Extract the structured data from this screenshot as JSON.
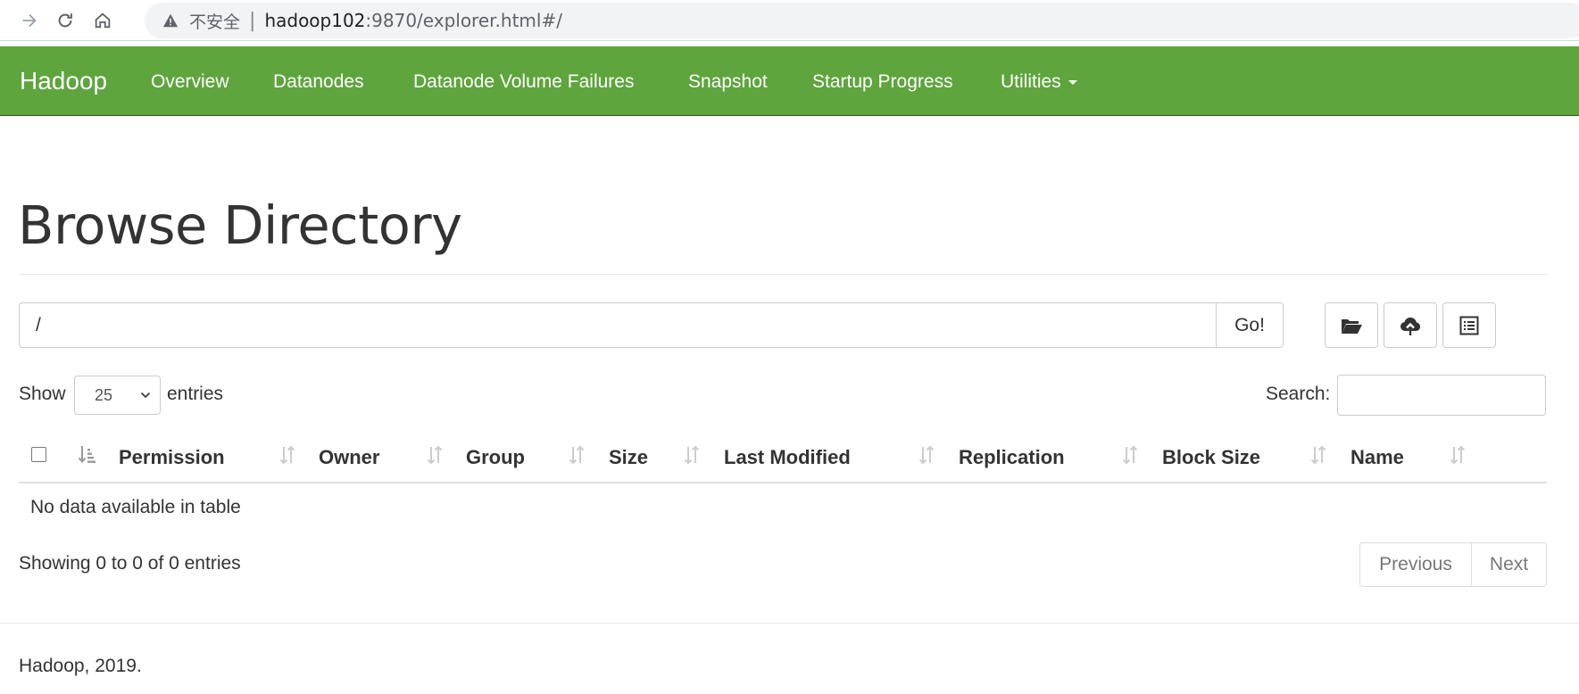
{
  "browser": {
    "insecure_label": "不安全",
    "url_host": "hadoop102",
    "url_rest": ":9870/explorer.html#/"
  },
  "navbar": {
    "brand": "Hadoop",
    "items": [
      {
        "label": "Overview"
      },
      {
        "label": "Datanodes"
      },
      {
        "label": "Datanode Volume Failures"
      },
      {
        "label": "Snapshot"
      },
      {
        "label": "Startup Progress"
      },
      {
        "label": "Utilities"
      }
    ]
  },
  "page": {
    "title": "Browse Directory",
    "path_value": "/",
    "go_label": "Go!",
    "toolbar_icons": [
      "folder-open-icon",
      "cloud-upload-icon",
      "list-icon"
    ]
  },
  "table_controls": {
    "show_label": "Show",
    "entries_value": "25",
    "entries_label": "entries",
    "search_label": "Search:"
  },
  "table": {
    "columns": [
      "Permission",
      "Owner",
      "Group",
      "Size",
      "Last Modified",
      "Replication",
      "Block Size",
      "Name"
    ],
    "empty_message": "No data available in table"
  },
  "pagination": {
    "info": "Showing 0 to 0 of 0 entries",
    "previous": "Previous",
    "next": "Next"
  },
  "footer": {
    "text": "Hadoop, 2019."
  },
  "colors": {
    "navbar_bg": "#5ea53d"
  }
}
